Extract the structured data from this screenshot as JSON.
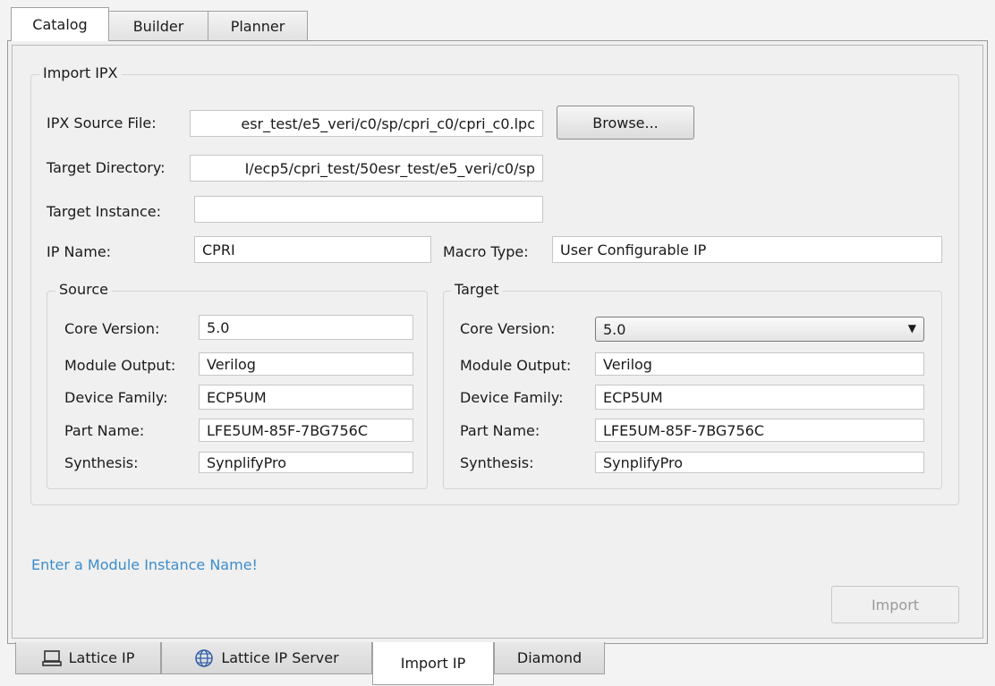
{
  "top_tabs": [
    {
      "label": "Catalog",
      "active": true
    },
    {
      "label": "Builder",
      "active": false
    },
    {
      "label": "Planner",
      "active": false
    }
  ],
  "import_group": {
    "title": "Import IPX",
    "ipx_source_label": "IPX Source File:",
    "ipx_source_value": "esr_test/e5_veri/c0/sp/cpri_c0/cpri_c0.lpc",
    "browse_label": "Browse...",
    "target_dir_label": "Target Directory:",
    "target_dir_value": "I/ecp5/cpri_test/50esr_test/e5_veri/c0/sp",
    "target_instance_label": "Target Instance:",
    "target_instance_value": "",
    "ip_name_label": "IP Name:",
    "ip_name_value": "CPRI",
    "macro_type_label": "Macro Type:",
    "macro_type_value": "User Configurable IP"
  },
  "source": {
    "title": "Source",
    "rows": [
      {
        "label": "Core Version:",
        "value": "5.0"
      },
      {
        "label": "Module Output:",
        "value": "Verilog"
      },
      {
        "label": "Device Family:",
        "value": "ECP5UM"
      },
      {
        "label": "Part Name:",
        "value": "LFE5UM-85F-7BG756C"
      },
      {
        "label": "Synthesis:",
        "value": "SynplifyPro"
      }
    ]
  },
  "target": {
    "title": "Target",
    "rows": [
      {
        "label": "Core Version:",
        "value": "5.0"
      },
      {
        "label": "Module Output:",
        "value": "Verilog"
      },
      {
        "label": "Device Family:",
        "value": "ECP5UM"
      },
      {
        "label": "Part Name:",
        "value": "LFE5UM-85F-7BG756C"
      },
      {
        "label": "Synthesis:",
        "value": "SynplifyPro"
      }
    ]
  },
  "status_message": "Enter a Module Instance Name!",
  "import_button_label": "Import",
  "bottom_tabs": [
    {
      "label": "Lattice IP",
      "icon": "laptop-icon",
      "active": false
    },
    {
      "label": "Lattice IP Server",
      "icon": "globe-icon",
      "active": false
    },
    {
      "label": "Import IP",
      "icon": "",
      "active": true
    },
    {
      "label": "Diamond",
      "icon": "",
      "active": false
    }
  ],
  "colors": {
    "status_text": "#3c8dcc",
    "background": "#f0f0f0"
  }
}
